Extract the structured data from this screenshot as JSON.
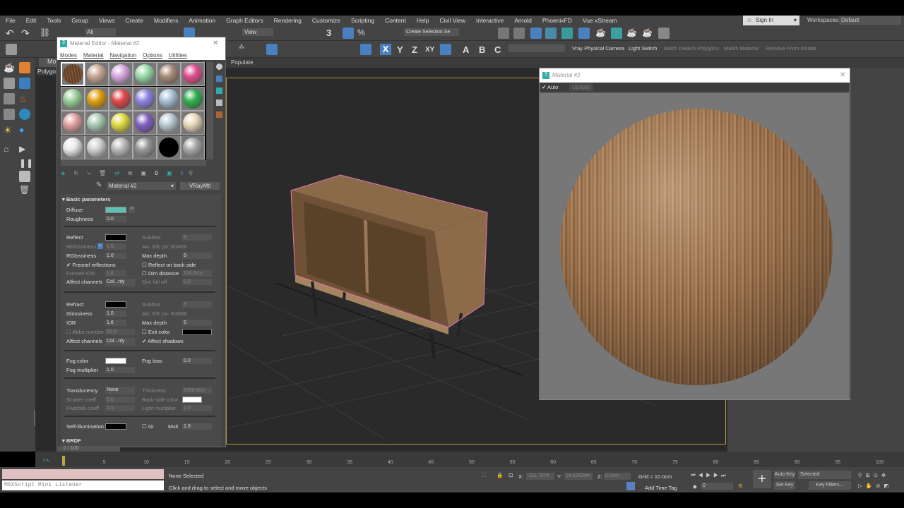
{
  "menu": [
    "File",
    "Edit",
    "Tools",
    "Group",
    "Views",
    "Create",
    "Modifiers",
    "Animation",
    "Graph Editors",
    "Rendering",
    "Customize",
    "Scripting",
    "Content",
    "Help",
    "Civil View",
    "Interactive",
    "Arnold",
    "PhoenixFD",
    "Vue xStream"
  ],
  "account": {
    "sign_in": "Sign In",
    "workspaces_label": "Workspaces:",
    "workspace": "Default"
  },
  "toolbar": {
    "selection_filter": "All",
    "ref_coord": "View",
    "named_selection": "Create Selection Se",
    "axis_x": "X",
    "axis_y": "Y",
    "axis_z": "Z",
    "axis_xy": "XY",
    "btn_a": "A",
    "btn_b": "B",
    "btn_c": "C",
    "vray_camera": "Vray Physical Camera",
    "light_switch": "Light Switch",
    "batch_detach": "Batch Detach Polygons",
    "match_material": "Match Material",
    "remove_isolate": "Remove From Isolate"
  },
  "ribbon": {
    "tab1": "Mo",
    "tab2": "Polygo",
    "populate": "Populate"
  },
  "material_editor": {
    "title": "Material Editor - Material #2",
    "menu": [
      "Modes",
      "Material",
      "Navigation",
      "Options",
      "Utilities"
    ],
    "slot_colors": [
      "#7a5232",
      "#c8a896",
      "#d8a8e0",
      "#98d8a8",
      "#a88c78",
      "#e05090",
      "#98d098",
      "#e0a010",
      "#e04848",
      "#8c84e0",
      "#a8c0d8",
      "#30b050",
      "#e0a0a0",
      "#a8c8b0",
      "#e0d840",
      "#8060c0",
      "#b8c8d0",
      "#e8d8b8",
      "#e8e8e8",
      "#d0d0d0",
      "#b8b8b8",
      "#989898",
      "#000000",
      "#a8a8a8"
    ],
    "material_name": "Material #2",
    "material_type": "VRayMtl",
    "section_basic": "Basic parameters",
    "section_brdf": "BRDF",
    "diffuse": {
      "label": "Diffuse",
      "color": "#5fbfb4",
      "map": "M"
    },
    "roughness": {
      "label": "Roughness",
      "value": "0.0"
    },
    "reflect": {
      "label": "Reflect",
      "color": "#000000",
      "subdivs_label": "Subdivs",
      "subdivs": "8",
      "hgloss_label": "HGlossiness",
      "hgloss": "1.0",
      "aa": "AA: 6/6; px: 6/3456",
      "rgloss_label": "RGlossiness",
      "rgloss": "1.0",
      "maxdepth_label": "Max depth",
      "maxdepth": "5",
      "fresnel": "Fresnel reflections",
      "backside": "Reflect on back side",
      "fresnel_ior_label": "Fresnel IOR",
      "fresnel_ior": "1.6",
      "dim_distance_label": "Dim distance",
      "dim_distance": "100.0cm",
      "affect_label": "Affect channels",
      "affect": "Col...nly",
      "dim_falloff_label": "Dim fall off",
      "dim_falloff": "0.0",
      "lock": "L"
    },
    "refract": {
      "label": "Refract",
      "color": "#000000",
      "subdivs_label": "Subdivs",
      "subdivs": "8",
      "gloss_label": "Glossiness",
      "gloss": "1.0",
      "aa": "AA: 6/6; px: 6/3456",
      "ior_label": "IOR",
      "ior": "1.6",
      "maxdepth_label": "Max depth",
      "maxdepth": "5",
      "abbe_label": "Abbe number",
      "abbe": "50.0",
      "exit_label": "Exit color",
      "affect_label": "Affect channels",
      "affect": "Col...nly",
      "affect_shadows": "Affect shadows"
    },
    "fog": {
      "color_label": "Fog color",
      "bias_label": "Fog bias",
      "bias": "0.0",
      "mult_label": "Fog multiplier",
      "mult": "1.0"
    },
    "translucency": {
      "label": "Translucency",
      "value": "None",
      "thickness_label": "Thickness",
      "thickness": "1000.0cm",
      "scatter_label": "Scatter coeff",
      "scatter": "0.0",
      "backside_label": "Back-side color",
      "fwd_label": "Fwd/bck coeff",
      "fwd": "1.0",
      "light_mult_label": "Light multiplier",
      "light_mult": "1.0"
    },
    "selfillum": {
      "label": "Self-illumination",
      "gi": "GI",
      "mult_label": "Mult",
      "mult": "1.0"
    }
  },
  "render_window": {
    "title": "Material #2",
    "auto": "Auto",
    "update": "Update"
  },
  "timeline": {
    "frame_counter": "0 / 100",
    "ticks": [
      "0",
      "5",
      "10",
      "15",
      "20",
      "25",
      "30",
      "35",
      "40",
      "45",
      "50",
      "55",
      "60",
      "65",
      "70",
      "75",
      "80",
      "85",
      "90",
      "95",
      "100"
    ]
  },
  "status": {
    "maxscript": "MAXScript Mini Listener",
    "selection": "None Selected",
    "prompt": "Click and drag to select and move objects",
    "x_label": "X:",
    "x": "-111.7874",
    "y_label": "Y:",
    "y": "24.6263cm",
    "z_label": "Z:",
    "z": "0.0cm",
    "grid": "Grid = 10.0cm",
    "add_time_tag": "Add Time Tag",
    "frame": "0",
    "auto_key": "Auto Key",
    "set_key": "Set Key",
    "key_mode": "Selected",
    "key_filters": "Key Filters..."
  }
}
